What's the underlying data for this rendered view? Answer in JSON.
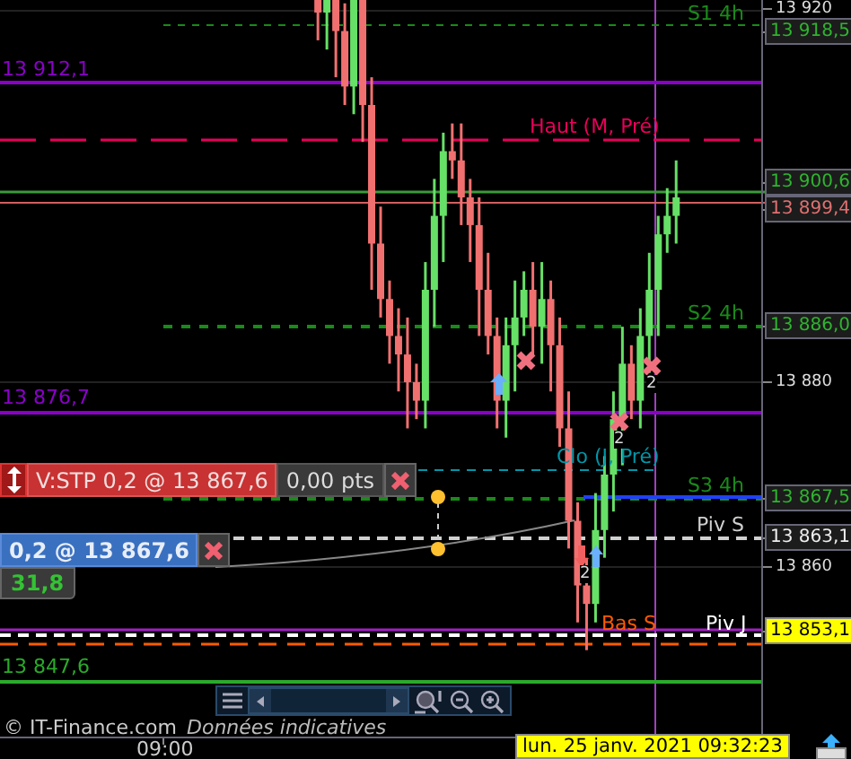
{
  "price_axis": {
    "labels": [
      {
        "text": "13 920",
        "kind": "plain"
      },
      {
        "text": "13 918,5",
        "kind": "green"
      },
      {
        "text": "13 900,6",
        "kind": "green"
      },
      {
        "text": "13 899,4",
        "kind": "red"
      },
      {
        "text": "13 886,0",
        "kind": "green"
      },
      {
        "text": "13 867,5",
        "kind": "green"
      },
      {
        "text": "13 863,1",
        "kind": "white"
      },
      {
        "text": "13 853,1",
        "kind": "yellow"
      }
    ]
  },
  "levels": [
    {
      "label": "S1 4h",
      "color": "#1a8a1a"
    },
    {
      "label": "13 912,1",
      "color": "#8a00c8"
    },
    {
      "label": "Haut (M, Pré)",
      "color": "#e8005a"
    },
    {
      "label": "S2 4h",
      "color": "#1a8a1a"
    },
    {
      "label": "13 876,7",
      "color": "#8a00c8"
    },
    {
      "label": "Clo (J, Pré)",
      "color": "#0096a8"
    },
    {
      "label": "S3 4h",
      "color": "#1a8a1a"
    },
    {
      "label": "Piv S",
      "color": "#d0d0d0"
    },
    {
      "label": "Piv J",
      "color": "#ffffff"
    },
    {
      "label": "Bas S",
      "color": "#ff5a00"
    },
    {
      "label": "13 847,6",
      "color": "#2aaa2a"
    }
  ],
  "markers": [
    {
      "kind": "cross"
    },
    {
      "kind": "cross",
      "count": "2"
    },
    {
      "kind": "cross",
      "count": "2"
    },
    {
      "kind": "up"
    },
    {
      "kind": "down-up",
      "count": "2"
    }
  ],
  "orders": [
    {
      "kind": "stop",
      "label": "V:STP 0,2 @ 13 867,6",
      "points": "0,00 pts"
    },
    {
      "kind": "limit",
      "label": "0,2 @ 13 867,6"
    }
  ],
  "chart_data": {
    "type": "candlestick",
    "ylim": [
      13841.55,
      13921.36
    ],
    "yticks": [
      {
        "value": 13880,
        "label": "13 880"
      },
      {
        "value": 13860,
        "label": "13 860"
      }
    ],
    "categories": [
      null,
      null,
      null,
      null,
      null,
      null,
      null,
      null,
      null,
      null,
      null,
      null,
      null,
      null,
      null,
      null,
      null,
      null,
      null,
      null,
      null,
      null,
      null,
      null,
      null,
      null,
      null,
      null,
      null,
      null,
      null,
      null,
      null,
      null,
      null,
      null,
      null,
      null,
      null,
      null,
      null,
      null,
      null,
      null,
      null,
      null,
      null,
      null,
      null,
      null,
      null,
      null,
      null,
      null,
      null,
      null,
      null,
      null,
      null,
      null,
      null,
      null,
      null,
      null,
      null,
      null,
      null,
      null,
      null,
      null,
      null,
      null,
      null,
      null,
      null,
      null,
      null,
      null,
      null,
      null,
      null,
      null,
      null,
      null,
      null
    ],
    "ohlc": [
      null,
      null,
      null,
      null,
      null,
      null,
      null,
      null,
      null,
      null,
      null,
      null,
      null,
      null,
      null,
      null,
      null,
      null,
      null,
      null,
      null,
      null,
      null,
      null,
      null,
      null,
      null,
      null,
      null,
      null,
      null,
      null,
      null,
      null,
      [
        13932,
        13934,
        13924,
        13928
      ],
      [
        13928,
        13931,
        13917,
        13920
      ],
      [
        13920,
        13930,
        13916,
        13926
      ],
      [
        13926,
        13928,
        13913,
        13918
      ],
      [
        13918,
        13921,
        13910,
        13912
      ],
      [
        13912,
        13928,
        13909,
        13924
      ],
      [
        13924,
        13926,
        13906,
        13910
      ],
      [
        13910,
        13913,
        13890,
        13895
      ],
      [
        13895,
        13899,
        13887,
        13889
      ],
      [
        13889,
        13891,
        13882,
        13885
      ],
      [
        13885,
        13888,
        13879,
        13883
      ],
      [
        13883,
        13887,
        13875,
        13880
      ],
      [
        13880,
        13882,
        13876,
        13878
      ],
      [
        13878,
        13893,
        13875,
        13890
      ],
      [
        13890,
        13902,
        13886,
        13898
      ],
      [
        13898,
        13907,
        13893,
        13905
      ],
      [
        13905,
        13908,
        13902,
        13904
      ],
      [
        13904,
        13908,
        13897,
        13900
      ],
      [
        13900,
        13902,
        13893,
        13897
      ],
      [
        13897,
        13900,
        13885,
        13890
      ],
      [
        13890,
        13894,
        13883,
        13885
      ],
      [
        13885,
        13887,
        13875,
        13878
      ],
      [
        13878,
        13887,
        13874,
        13884
      ],
      [
        13884,
        13891,
        13879,
        13887
      ],
      [
        13887,
        13892,
        13885,
        13890
      ],
      [
        13890,
        13893,
        13883,
        13886
      ],
      [
        13886,
        13893,
        13882,
        13889
      ],
      [
        13889,
        13891,
        13879,
        13884
      ],
      [
        13884,
        13887,
        13873,
        13875
      ],
      [
        13875,
        13879,
        13862,
        13865
      ],
      [
        13865,
        13867,
        13854,
        13858
      ],
      [
        13858,
        13861,
        13851,
        13856
      ],
      [
        13856,
        13868,
        13854,
        13864
      ],
      [
        13864,
        13872,
        13861,
        13870
      ],
      [
        13870,
        13879,
        13866,
        13876
      ],
      [
        13876,
        13886,
        13871,
        13882
      ],
      [
        13882,
        13884,
        13876,
        13878
      ],
      [
        13878,
        13888,
        13875,
        13885
      ],
      [
        13885,
        13894,
        13881,
        13890
      ],
      [
        13890,
        13898,
        13885,
        13896
      ],
      [
        13896,
        13901,
        13894,
        13898
      ],
      [
        13898,
        13904,
        13895,
        13900
      ],
      null,
      null,
      null,
      null,
      null,
      null,
      null,
      null,
      null
    ]
  },
  "pnl": "31,8",
  "footer": {
    "copyright": "© IT-Finance.com",
    "disclaimer": "Données indicatives"
  },
  "time_axis": {
    "labels": [
      "09:00"
    ]
  },
  "crosshair": {
    "datetime": "lun. 25 janv. 2021 09:32:23"
  }
}
